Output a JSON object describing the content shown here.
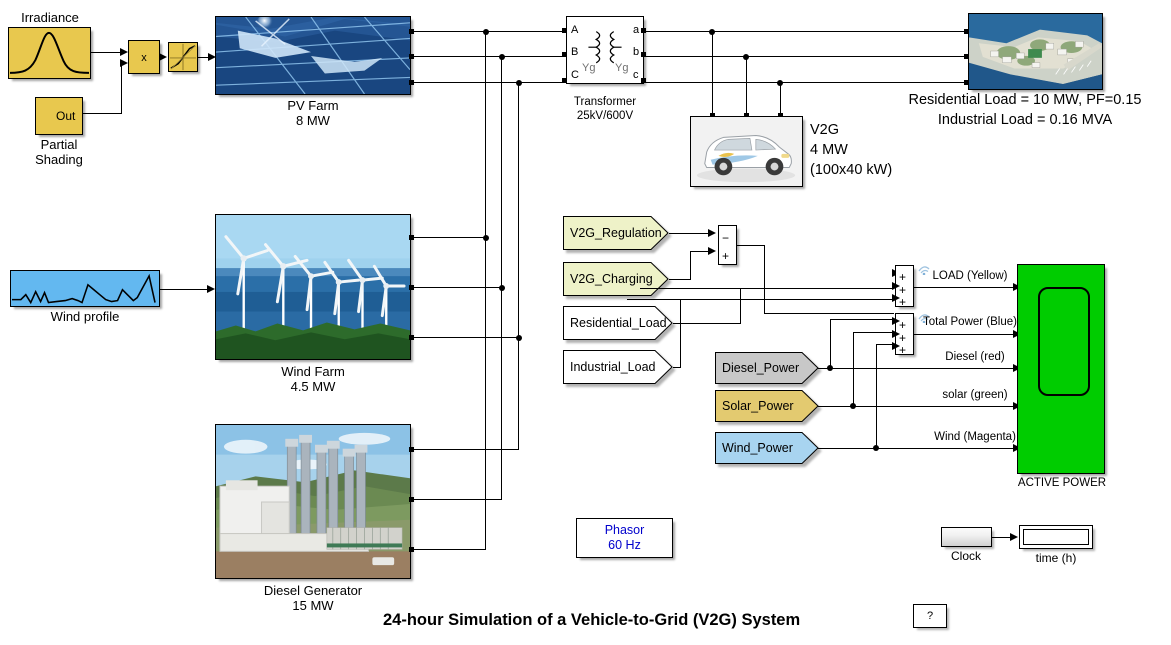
{
  "diagram": {
    "title": "24-hour Simulation of a Vehicle-to-Grid (V2G) System",
    "help_label": "?"
  },
  "sources": {
    "irradiance_label": "Irradiance",
    "partial_shading_label_1": "Partial",
    "partial_shading_label_2": "Shading",
    "partial_shading_port": "Out",
    "product_label": "x",
    "wind_profile_label": "Wind profile"
  },
  "plants": {
    "pv": {
      "name": "PV Farm",
      "rating": "8 MW"
    },
    "wind": {
      "name": "Wind Farm",
      "rating": "4.5 MW"
    },
    "diesel": {
      "name": "Diesel Generator",
      "rating": "15 MW"
    },
    "v2g": {
      "name": "V2G",
      "rating": "4 MW",
      "detail": "(100x40 kW)"
    }
  },
  "transformer": {
    "name": "Transformer",
    "rating": "25kV/600V",
    "in_ports": [
      "A",
      "B",
      "C"
    ],
    "out_ports": [
      "a",
      "b",
      "c"
    ],
    "winding_left": "Yg",
    "winding_right": "Yg"
  },
  "load": {
    "residential": "Residential Load = 10 MW, PF=0.15",
    "industrial": "Industrial Load = 0.16 MVA"
  },
  "tags": [
    {
      "label": "V2G_Regulation",
      "color": "#eef2c8"
    },
    {
      "label": "V2G_Charging",
      "color": "#eef2c8"
    },
    {
      "label": "Residential_Load",
      "color": "#ffffff"
    },
    {
      "label": "Industrial_Load",
      "color": "#ffffff"
    },
    {
      "label": "Diesel_Power",
      "color": "#c8c8c8"
    },
    {
      "label": "Solar_Power",
      "color": "#e3ca70"
    },
    {
      "label": "Wind_Power",
      "color": "#a8d4f0"
    }
  ],
  "sum_blocks": [
    {
      "signs": [
        "−",
        "+"
      ]
    },
    {
      "signs": [
        "+",
        "+",
        "+"
      ]
    },
    {
      "signs": [
        "+",
        "+",
        "+"
      ]
    }
  ],
  "scope": {
    "name": "ACTIVE POWER",
    "traces": [
      "LOAD (Yellow)",
      "Total Power (Blue)",
      "Diesel (red)",
      "solar (green)",
      "Wind (Magenta)"
    ],
    "color": "#00cc00"
  },
  "powergui": {
    "line1": "Phasor",
    "line2": "60 Hz",
    "color": "#0000cc"
  },
  "clock": {
    "label": "Clock",
    "display_label": "time (h)"
  }
}
